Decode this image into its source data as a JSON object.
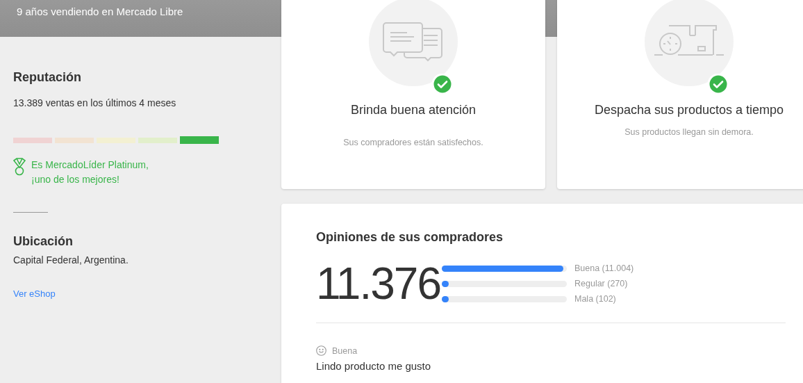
{
  "header": {
    "text": "9 años vendiendo en Mercado Libre"
  },
  "reputation": {
    "title": "Reputación",
    "sales": "13.389 ventas en los últimos 4 meses",
    "thermometer": [
      {
        "color": "#f0d3d3",
        "selected": false
      },
      {
        "color": "#f2e3d2",
        "selected": false
      },
      {
        "color": "#f3f0d2",
        "selected": false
      },
      {
        "color": "#e2efcb",
        "selected": false
      },
      {
        "color": "#39b54a",
        "selected": true
      }
    ],
    "badge": {
      "lines": [
        "Es MercadoLíder Platinum,",
        "¡uno de los mejores!"
      ]
    }
  },
  "location": {
    "title": "Ubicación",
    "text": "Capital Federal, Argentina.",
    "link": "Ver eShop"
  },
  "features": [
    {
      "kind": "chat",
      "title": "Brinda buena atención",
      "subtitle": "Sus compradores están satisfechos.",
      "checked": true
    },
    {
      "kind": "shipping",
      "title": "Despacha sus productos a tiempo",
      "subtitle": "Sus productos llegan sin demora.",
      "checked": true
    }
  ],
  "opinions": {
    "title": "Opiniones de sus compradores",
    "total": "11.376",
    "ratings": [
      {
        "label": "Buena (11.004)",
        "level": 0.97
      },
      {
        "label": "Regular (270)",
        "level": 0.024
      },
      {
        "label": "Mala (102)",
        "level": 0.009
      }
    ],
    "reviews": [
      {
        "rating": "Buena",
        "text": "Lindo producto me gusto"
      }
    ]
  }
}
